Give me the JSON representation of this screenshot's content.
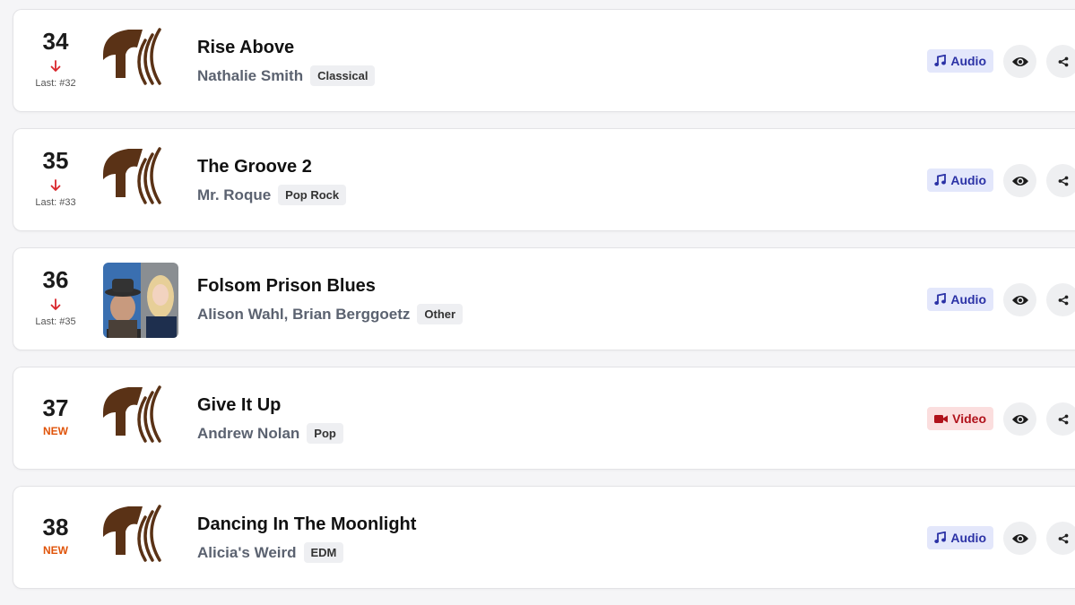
{
  "labels": {
    "last_prefix": "Last: #",
    "audio": "Audio",
    "video": "Video",
    "new": "NEW"
  },
  "colors": {
    "logo_brown": "#5a3216",
    "down_arrow": "#d9262c",
    "new_orange": "#e0540a",
    "audio_bg": "#e3e7fb",
    "audio_text": "#2b32a6",
    "video_bg": "#fbdede",
    "video_text": "#b0111a"
  },
  "entries": [
    {
      "rank": "34",
      "movement": "down",
      "last": "32",
      "title": "Rise Above",
      "artist": "Nathalie Smith",
      "genre": "Classical",
      "media": "audio",
      "cover": "logo"
    },
    {
      "rank": "35",
      "movement": "down",
      "last": "33",
      "title": "The Groove 2",
      "artist": "Mr. Roque",
      "genre": "Pop Rock",
      "media": "audio",
      "cover": "logo"
    },
    {
      "rank": "36",
      "movement": "down",
      "last": "35",
      "title": "Folsom Prison Blues",
      "artist": "Alison Wahl, Brian Berggoetz",
      "genre": "Other",
      "media": "audio",
      "cover": "photo"
    },
    {
      "rank": "37",
      "movement": "new",
      "last": "",
      "title": "Give It Up",
      "artist": "Andrew Nolan",
      "genre": "Pop",
      "media": "video",
      "cover": "logo"
    },
    {
      "rank": "38",
      "movement": "new",
      "last": "",
      "title": "Dancing In The Moonlight",
      "artist": "Alicia's Weird",
      "genre": "EDM",
      "media": "audio",
      "cover": "logo"
    }
  ]
}
